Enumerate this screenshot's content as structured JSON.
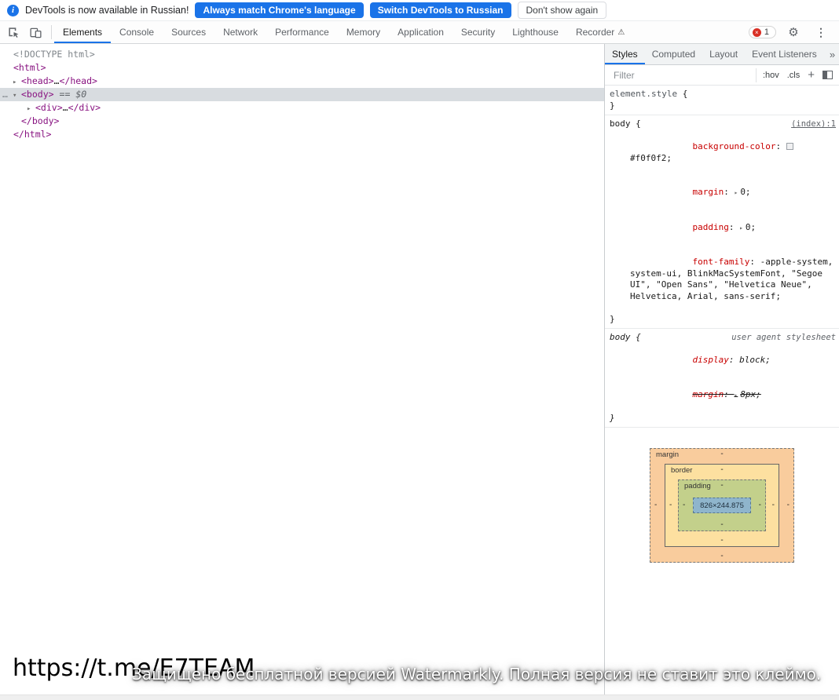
{
  "colors": {
    "accent": "#1a73e8",
    "error": "#d93025"
  },
  "notification": {
    "icon": "info-icon",
    "icon_glyph": "i",
    "message": "DevTools is now available in Russian!",
    "buttons": [
      {
        "label": "Always match Chrome's language"
      },
      {
        "label": "Switch DevTools to Russian"
      },
      {
        "label": "Don't show again"
      }
    ]
  },
  "toolbar": {
    "tabs": [
      {
        "label": "Elements"
      },
      {
        "label": "Console"
      },
      {
        "label": "Sources"
      },
      {
        "label": "Network"
      },
      {
        "label": "Performance"
      },
      {
        "label": "Memory"
      },
      {
        "label": "Application"
      },
      {
        "label": "Security"
      },
      {
        "label": "Lighthouse"
      },
      {
        "label": "Recorder"
      }
    ],
    "recorder_badge": "⚠",
    "error_icon_glyph": "×",
    "error_badge": "1",
    "gear_glyph": "⚙",
    "kebab_glyph": "⋮"
  },
  "tree": {
    "gutter_dots": "…",
    "arrow_collapsed": "▸",
    "arrow_expanded": "▾",
    "doctype": "<!DOCTYPE html>",
    "html_open": "<html>",
    "head_open": "<head>",
    "ellipsis": "…",
    "head_close": "</head>",
    "body_open": "<body>",
    "body_marker": "== $0",
    "div_open": "<div>",
    "div_close": "</div>",
    "body_close": "</body>",
    "html_close": "</html>"
  },
  "styles": {
    "tabs": [
      {
        "label": "Styles"
      },
      {
        "label": "Computed"
      },
      {
        "label": "Layout"
      },
      {
        "label": "Event Listeners"
      }
    ],
    "overflow": "»",
    "filter_placeholder": "Filter",
    "hov": ":hov",
    "cls": ".cls",
    "plus": "+",
    "colon": ": ",
    "expand_arrow": "▸",
    "element_style": {
      "selector": "element.style",
      "open": " {",
      "close": "}"
    },
    "body_rule": {
      "selector": "body {",
      "source": "(index):1",
      "props": [
        {
          "name": "background-color",
          "value": "#f0f0f2;",
          "swatch": "#f0f0f2"
        },
        {
          "name": "margin",
          "value": "0;"
        },
        {
          "name": "padding",
          "value": "0;"
        },
        {
          "name": "font-family",
          "value": "-apple-system, system-ui, BlinkMacSystemFont, \"Segoe UI\", \"Open Sans\", \"Helvetica Neue\", Helvetica, Arial, sans-serif;"
        }
      ],
      "close": "}"
    },
    "ua_rule": {
      "selector": "body {",
      "source": "user agent stylesheet",
      "props": [
        {
          "name": "display",
          "value": "block;"
        },
        {
          "name": "margin",
          "value": "8px;"
        }
      ],
      "close": "}"
    },
    "box_model": {
      "margin_label": "margin",
      "border_label": "border",
      "padding_label": "padding",
      "content": "826×244.875",
      "dash": "-",
      "colors": {
        "margin": "#f9cc9d",
        "border": "#fde0a0",
        "padding": "#c3d08b",
        "content": "#8fb5cc"
      }
    }
  },
  "watermark": {
    "url": "https://t.me/E7TEAM",
    "text": "Защищено бесплатной версией Watermarkly. Полная версия не ставит это клеймо."
  }
}
